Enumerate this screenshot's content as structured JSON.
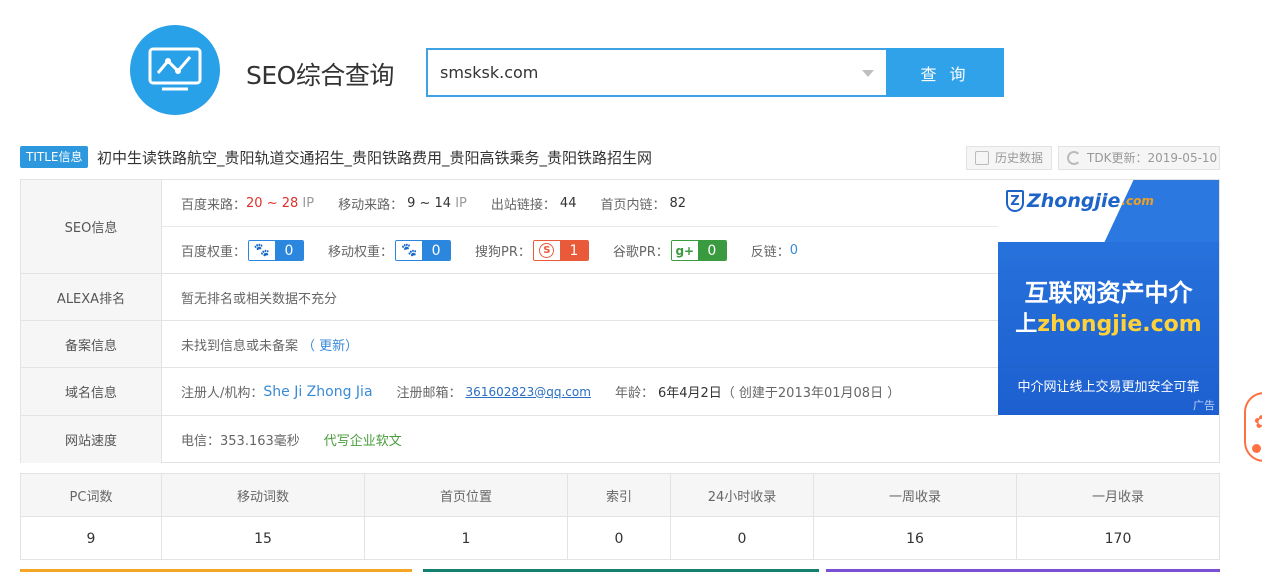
{
  "header": {
    "app_title": "SEO综合查询",
    "search_value": "smsksk.com",
    "search_button": "查 询"
  },
  "title_bar": {
    "tag": "TITLE信息",
    "text": "初中生读铁路航空_贵阳轨道交通招生_贵阳铁路费用_贵阳高铁乘务_贵阳铁路招生网",
    "history_label": "历史数据",
    "tdk_label": "TDK更新：2019-05-10"
  },
  "seo_info": {
    "label": "SEO信息",
    "baidu_traffic_label": "百度来路：",
    "baidu_traffic_low": "20",
    "baidu_traffic_sep": " ~ ",
    "baidu_traffic_high": "28",
    "baidu_traffic_unit": " IP",
    "mobile_traffic_label": "移动来路：",
    "mobile_traffic_value": "9 ~ 14",
    "mobile_traffic_unit": " IP",
    "outbound_label": "出站链接：",
    "outbound_value": "44",
    "internal_label": "首页内链：",
    "internal_value": "82",
    "baidu_weight_label": "百度权重：",
    "baidu_weight_value": "0",
    "mobile_weight_label": "移动权重：",
    "mobile_weight_value": "0",
    "sogou_pr_label": "搜狗PR：",
    "sogou_pr_value": "1",
    "google_pr_label": "谷歌PR：",
    "google_pr_value": "0",
    "backlink_label": "反链：",
    "backlink_value": "0"
  },
  "alexa": {
    "label": "ALEXA排名",
    "value": "暂无排名或相关数据不充分"
  },
  "icp": {
    "label": "备案信息",
    "value": "未找到信息或未备案",
    "update_link": "（ 更新）"
  },
  "domain": {
    "label": "域名信息",
    "registrant_label": "注册人/机构：",
    "registrant_value": "She Ji Zhong Jia",
    "email_label": "注册邮箱：",
    "email_value": "361602823@qq.com",
    "age_label": "年龄：",
    "age_value": "6年4月2日",
    "created": "（ 创建于2013年01月08日 ）"
  },
  "speed": {
    "label": "网站速度",
    "value": "电信：353.163毫秒",
    "ad_link": "代写企业软文"
  },
  "ad": {
    "logo_text": "Zhongjie",
    "logo_suffix": ".com",
    "line1": "互联网资产中介",
    "line2_prefix": "上",
    "line2_domain": "zhongjie.com",
    "line3": "中介网让线上交易更加安全可靠",
    "mark": "广告"
  },
  "stats": {
    "headers": [
      "PC词数",
      "移动词数",
      "首页位置",
      "索引",
      "24小时收录",
      "一周收录",
      "一月收录"
    ],
    "values": [
      "9",
      "15",
      "1",
      "0",
      "0",
      "16",
      "170"
    ]
  },
  "colors": {
    "accent": "#2fa2ea",
    "red": "#e0302c",
    "link_blue": "#3a8ad6",
    "green": "#4a9d3c"
  }
}
